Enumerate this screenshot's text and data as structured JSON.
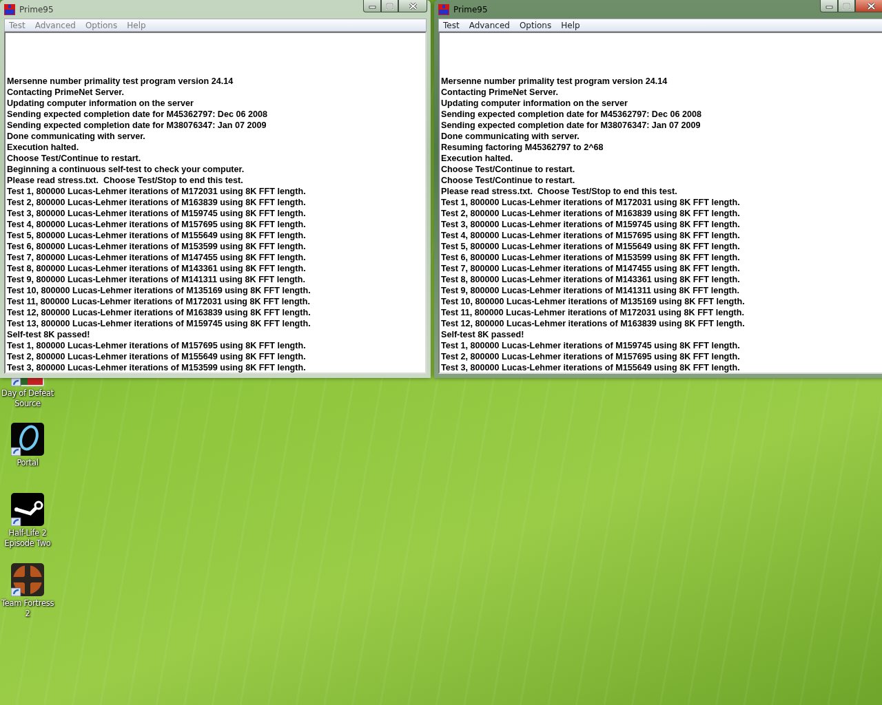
{
  "windows": [
    {
      "title": "Prime95",
      "active": false,
      "menu": [
        "Test",
        "Advanced",
        "Options",
        "Help"
      ],
      "log": [
        "Mersenne number primality test program version 24.14",
        "Contacting PrimeNet Server.",
        "Updating computer information on the server",
        "Sending expected completion date for M45362797: Dec 06 2008",
        "Sending expected completion date for M38076347: Jan 07 2009",
        "Done communicating with server.",
        "Execution halted.",
        "Choose Test/Continue to restart.",
        "Beginning a continuous self-test to check your computer.",
        "Please read stress.txt.  Choose Test/Stop to end this test.",
        "Test 1, 800000 Lucas-Lehmer iterations of M172031 using 8K FFT length.",
        "Test 2, 800000 Lucas-Lehmer iterations of M163839 using 8K FFT length.",
        "Test 3, 800000 Lucas-Lehmer iterations of M159745 using 8K FFT length.",
        "Test 4, 800000 Lucas-Lehmer iterations of M157695 using 8K FFT length.",
        "Test 5, 800000 Lucas-Lehmer iterations of M155649 using 8K FFT length.",
        "Test 6, 800000 Lucas-Lehmer iterations of M153599 using 8K FFT length.",
        "Test 7, 800000 Lucas-Lehmer iterations of M147455 using 8K FFT length.",
        "Test 8, 800000 Lucas-Lehmer iterations of M143361 using 8K FFT length.",
        "Test 9, 800000 Lucas-Lehmer iterations of M141311 using 8K FFT length.",
        "Test 10, 800000 Lucas-Lehmer iterations of M135169 using 8K FFT length.",
        "Test 11, 800000 Lucas-Lehmer iterations of M172031 using 8K FFT length.",
        "Test 12, 800000 Lucas-Lehmer iterations of M163839 using 8K FFT length.",
        "Test 13, 800000 Lucas-Lehmer iterations of M159745 using 8K FFT length.",
        "Self-test 8K passed!",
        "Test 1, 800000 Lucas-Lehmer iterations of M157695 using 8K FFT length.",
        "Test 2, 800000 Lucas-Lehmer iterations of M155649 using 8K FFT length.",
        "Test 3, 800000 Lucas-Lehmer iterations of M153599 using 8K FFT length."
      ]
    },
    {
      "title": "Prime95",
      "active": true,
      "menu": [
        "Test",
        "Advanced",
        "Options",
        "Help"
      ],
      "log": [
        "Mersenne number primality test program version 24.14",
        "Contacting PrimeNet Server.",
        "Updating computer information on the server",
        "Sending expected completion date for M45362797: Dec 06 2008",
        "Sending expected completion date for M38076347: Jan 07 2009",
        "Done communicating with server.",
        "Resuming factoring M45362797 to 2^68",
        "Execution halted.",
        "Choose Test/Continue to restart.",
        "Choose Test/Continue to restart.",
        "Please read stress.txt.  Choose Test/Stop to end this test.",
        "Test 1, 800000 Lucas-Lehmer iterations of M172031 using 8K FFT length.",
        "Test 2, 800000 Lucas-Lehmer iterations of M163839 using 8K FFT length.",
        "Test 3, 800000 Lucas-Lehmer iterations of M159745 using 8K FFT length.",
        "Test 4, 800000 Lucas-Lehmer iterations of M157695 using 8K FFT length.",
        "Test 5, 800000 Lucas-Lehmer iterations of M155649 using 8K FFT length.",
        "Test 6, 800000 Lucas-Lehmer iterations of M153599 using 8K FFT length.",
        "Test 7, 800000 Lucas-Lehmer iterations of M147455 using 8K FFT length.",
        "Test 8, 800000 Lucas-Lehmer iterations of M143361 using 8K FFT length.",
        "Test 9, 800000 Lucas-Lehmer iterations of M141311 using 8K FFT length.",
        "Test 10, 800000 Lucas-Lehmer iterations of M135169 using 8K FFT length.",
        "Test 11, 800000 Lucas-Lehmer iterations of M172031 using 8K FFT length.",
        "Test 12, 800000 Lucas-Lehmer iterations of M163839 using 8K FFT length.",
        "Self-test 8K passed!",
        "Test 1, 800000 Lucas-Lehmer iterations of M159745 using 8K FFT length.",
        "Test 2, 800000 Lucas-Lehmer iterations of M157695 using 8K FFT length.",
        "Test 3, 800000 Lucas-Lehmer iterations of M155649 using 8K FFT length."
      ]
    }
  ],
  "desktop_icons": [
    {
      "label": "Day of Defeat Source",
      "kind": "flag"
    },
    {
      "label": "Portal",
      "kind": "ring"
    },
    {
      "label": "Half-Life 2 Episode Two",
      "kind": "pipe"
    },
    {
      "label": "Team Fortress 2",
      "kind": "cross"
    }
  ]
}
